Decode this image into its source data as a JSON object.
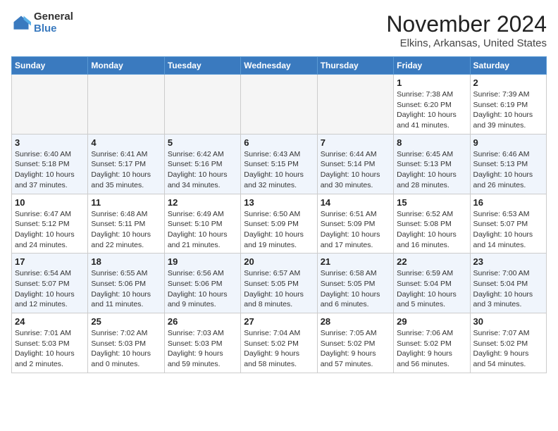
{
  "header": {
    "logo_line1": "General",
    "logo_line2": "Blue",
    "month": "November 2024",
    "location": "Elkins, Arkansas, United States"
  },
  "weekdays": [
    "Sunday",
    "Monday",
    "Tuesday",
    "Wednesday",
    "Thursday",
    "Friday",
    "Saturday"
  ],
  "weeks": [
    [
      {
        "day": "",
        "info": ""
      },
      {
        "day": "",
        "info": ""
      },
      {
        "day": "",
        "info": ""
      },
      {
        "day": "",
        "info": ""
      },
      {
        "day": "",
        "info": ""
      },
      {
        "day": "1",
        "info": "Sunrise: 7:38 AM\nSunset: 6:20 PM\nDaylight: 10 hours\nand 41 minutes."
      },
      {
        "day": "2",
        "info": "Sunrise: 7:39 AM\nSunset: 6:19 PM\nDaylight: 10 hours\nand 39 minutes."
      }
    ],
    [
      {
        "day": "3",
        "info": "Sunrise: 6:40 AM\nSunset: 5:18 PM\nDaylight: 10 hours\nand 37 minutes."
      },
      {
        "day": "4",
        "info": "Sunrise: 6:41 AM\nSunset: 5:17 PM\nDaylight: 10 hours\nand 35 minutes."
      },
      {
        "day": "5",
        "info": "Sunrise: 6:42 AM\nSunset: 5:16 PM\nDaylight: 10 hours\nand 34 minutes."
      },
      {
        "day": "6",
        "info": "Sunrise: 6:43 AM\nSunset: 5:15 PM\nDaylight: 10 hours\nand 32 minutes."
      },
      {
        "day": "7",
        "info": "Sunrise: 6:44 AM\nSunset: 5:14 PM\nDaylight: 10 hours\nand 30 minutes."
      },
      {
        "day": "8",
        "info": "Sunrise: 6:45 AM\nSunset: 5:13 PM\nDaylight: 10 hours\nand 28 minutes."
      },
      {
        "day": "9",
        "info": "Sunrise: 6:46 AM\nSunset: 5:13 PM\nDaylight: 10 hours\nand 26 minutes."
      }
    ],
    [
      {
        "day": "10",
        "info": "Sunrise: 6:47 AM\nSunset: 5:12 PM\nDaylight: 10 hours\nand 24 minutes."
      },
      {
        "day": "11",
        "info": "Sunrise: 6:48 AM\nSunset: 5:11 PM\nDaylight: 10 hours\nand 22 minutes."
      },
      {
        "day": "12",
        "info": "Sunrise: 6:49 AM\nSunset: 5:10 PM\nDaylight: 10 hours\nand 21 minutes."
      },
      {
        "day": "13",
        "info": "Sunrise: 6:50 AM\nSunset: 5:09 PM\nDaylight: 10 hours\nand 19 minutes."
      },
      {
        "day": "14",
        "info": "Sunrise: 6:51 AM\nSunset: 5:09 PM\nDaylight: 10 hours\nand 17 minutes."
      },
      {
        "day": "15",
        "info": "Sunrise: 6:52 AM\nSunset: 5:08 PM\nDaylight: 10 hours\nand 16 minutes."
      },
      {
        "day": "16",
        "info": "Sunrise: 6:53 AM\nSunset: 5:07 PM\nDaylight: 10 hours\nand 14 minutes."
      }
    ],
    [
      {
        "day": "17",
        "info": "Sunrise: 6:54 AM\nSunset: 5:07 PM\nDaylight: 10 hours\nand 12 minutes."
      },
      {
        "day": "18",
        "info": "Sunrise: 6:55 AM\nSunset: 5:06 PM\nDaylight: 10 hours\nand 11 minutes."
      },
      {
        "day": "19",
        "info": "Sunrise: 6:56 AM\nSunset: 5:06 PM\nDaylight: 10 hours\nand 9 minutes."
      },
      {
        "day": "20",
        "info": "Sunrise: 6:57 AM\nSunset: 5:05 PM\nDaylight: 10 hours\nand 8 minutes."
      },
      {
        "day": "21",
        "info": "Sunrise: 6:58 AM\nSunset: 5:05 PM\nDaylight: 10 hours\nand 6 minutes."
      },
      {
        "day": "22",
        "info": "Sunrise: 6:59 AM\nSunset: 5:04 PM\nDaylight: 10 hours\nand 5 minutes."
      },
      {
        "day": "23",
        "info": "Sunrise: 7:00 AM\nSunset: 5:04 PM\nDaylight: 10 hours\nand 3 minutes."
      }
    ],
    [
      {
        "day": "24",
        "info": "Sunrise: 7:01 AM\nSunset: 5:03 PM\nDaylight: 10 hours\nand 2 minutes."
      },
      {
        "day": "25",
        "info": "Sunrise: 7:02 AM\nSunset: 5:03 PM\nDaylight: 10 hours\nand 0 minutes."
      },
      {
        "day": "26",
        "info": "Sunrise: 7:03 AM\nSunset: 5:03 PM\nDaylight: 9 hours\nand 59 minutes."
      },
      {
        "day": "27",
        "info": "Sunrise: 7:04 AM\nSunset: 5:02 PM\nDaylight: 9 hours\nand 58 minutes."
      },
      {
        "day": "28",
        "info": "Sunrise: 7:05 AM\nSunset: 5:02 PM\nDaylight: 9 hours\nand 57 minutes."
      },
      {
        "day": "29",
        "info": "Sunrise: 7:06 AM\nSunset: 5:02 PM\nDaylight: 9 hours\nand 56 minutes."
      },
      {
        "day": "30",
        "info": "Sunrise: 7:07 AM\nSunset: 5:02 PM\nDaylight: 9 hours\nand 54 minutes."
      }
    ]
  ]
}
